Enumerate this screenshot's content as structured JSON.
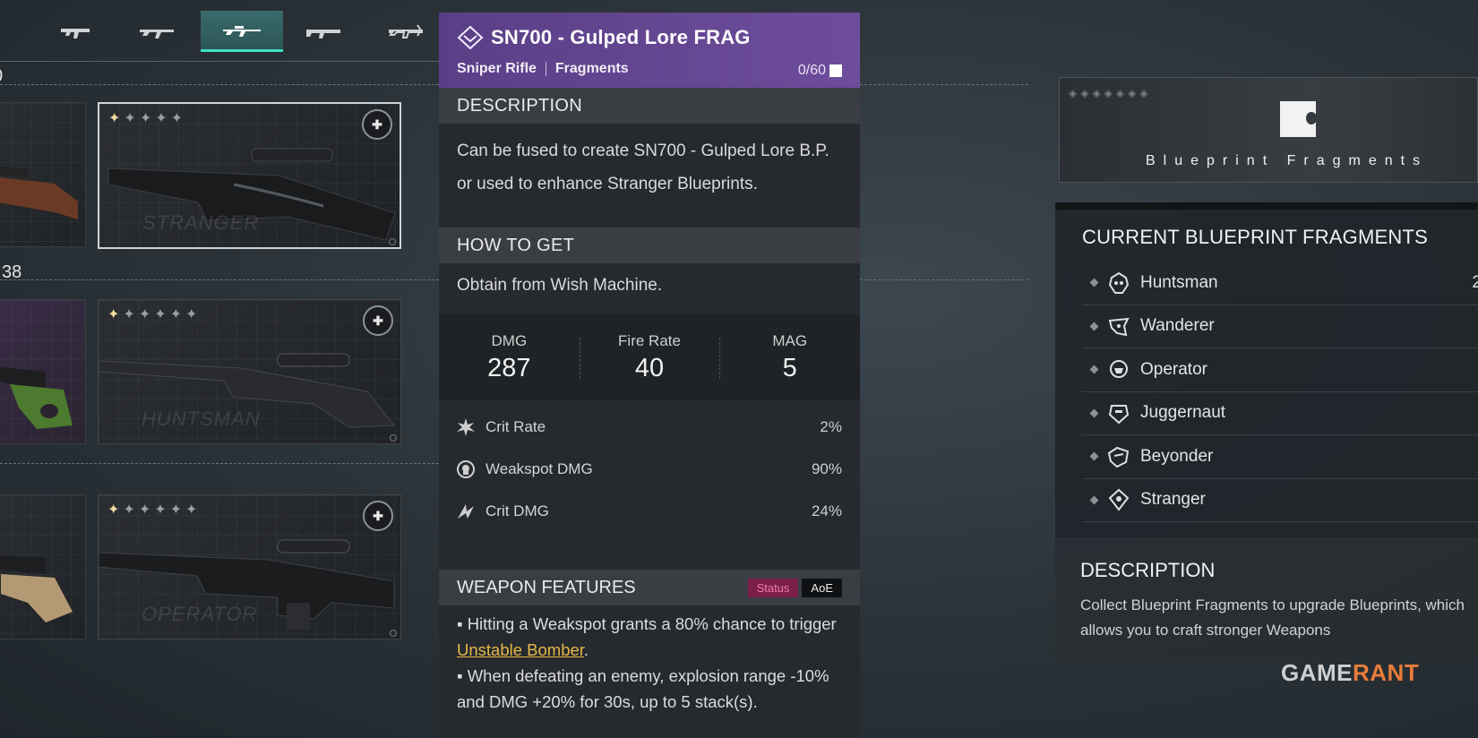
{
  "tabs": [
    {
      "name": "tab-weapon-0",
      "icon": "pistol-icon",
      "active": false
    },
    {
      "name": "tab-weapon-1",
      "icon": "smg-icon",
      "active": false
    },
    {
      "name": "tab-weapon-2",
      "icon": "rifle-icon",
      "active": false
    },
    {
      "name": "tab-weapon-3",
      "icon": "sniper-rifle-icon",
      "active": true
    },
    {
      "name": "tab-weapon-4",
      "icon": "shotgun-icon",
      "active": false
    },
    {
      "name": "tab-weapon-5",
      "icon": "crossbow-icon",
      "active": false
    }
  ],
  "left": {
    "row1_count": "0",
    "row2_count": "38"
  },
  "cards": [
    {
      "name": "card-stranger",
      "stars_lit": 1,
      "stars_total": 5,
      "brand": "STRANGER",
      "selected": true
    },
    {
      "name": "card-huntsman",
      "stars_lit": 1,
      "stars_total": 6,
      "brand": "HUNTSMAN",
      "selected": false
    },
    {
      "name": "card-operator",
      "stars_lit": 1,
      "stars_total": 6,
      "brand": "OPERATOR",
      "selected": false
    }
  ],
  "item": {
    "title": "SN700 - Gulped Lore FRAG",
    "type": "Sniper Rifle",
    "category": "Fragments",
    "count": "0/60",
    "rarity_color": "#6a4b98",
    "description_header": "DESCRIPTION",
    "description": "Can be fused to create SN700 - Gulped Lore B.P. or used to enhance Stranger Blueprints.",
    "how_header": "HOW TO GET",
    "how_text": "Obtain from Wish Machine.",
    "stats": [
      {
        "label": "DMG",
        "value": "287"
      },
      {
        "label": "Fire Rate",
        "value": "40"
      },
      {
        "label": "MAG",
        "value": "5"
      }
    ],
    "attributes": [
      {
        "icon": "crit-rate-icon",
        "name": "Crit Rate",
        "value": "2%"
      },
      {
        "icon": "weakspot-icon",
        "name": "Weakspot DMG",
        "value": "90%"
      },
      {
        "icon": "crit-dmg-icon",
        "name": "Crit DMG",
        "value": "24%"
      }
    ],
    "features_header": "WEAPON FEATURES",
    "tags": {
      "status": "Status",
      "aoe": "AoE"
    },
    "feature1_pre": "▪ Hitting a Weakspot grants a 80% chance to trigger ",
    "feature1_link": "Unstable Bomber",
    "feature1_post": ".",
    "feature2": "▪ When defeating an enemy, explosion range -10% and DMG +20% for 30s, up to 5 stack(s)."
  },
  "blueprint": {
    "banner_label": "Blueprint Fragments",
    "current_title": "CURRENT BLUEPRINT FRAGMENTS",
    "fragments": [
      {
        "name": "Huntsman",
        "icon": "huntsman-icon",
        "trail": "2"
      },
      {
        "name": "Wanderer",
        "icon": "wanderer-icon",
        "trail": ""
      },
      {
        "name": "Operator",
        "icon": "operator-icon",
        "trail": ""
      },
      {
        "name": "Juggernaut",
        "icon": "juggernaut-icon",
        "trail": ""
      },
      {
        "name": "Beyonder",
        "icon": "beyonder-icon",
        "trail": ""
      },
      {
        "name": "Stranger",
        "icon": "stranger-icon",
        "trail": ""
      }
    ],
    "desc_title": "DESCRIPTION",
    "desc_text": "Collect Blueprint Fragments to upgrade Blueprints, which allows you to craft stronger Weapons"
  },
  "watermark": {
    "part1": "GAME",
    "part2": "RANT"
  }
}
